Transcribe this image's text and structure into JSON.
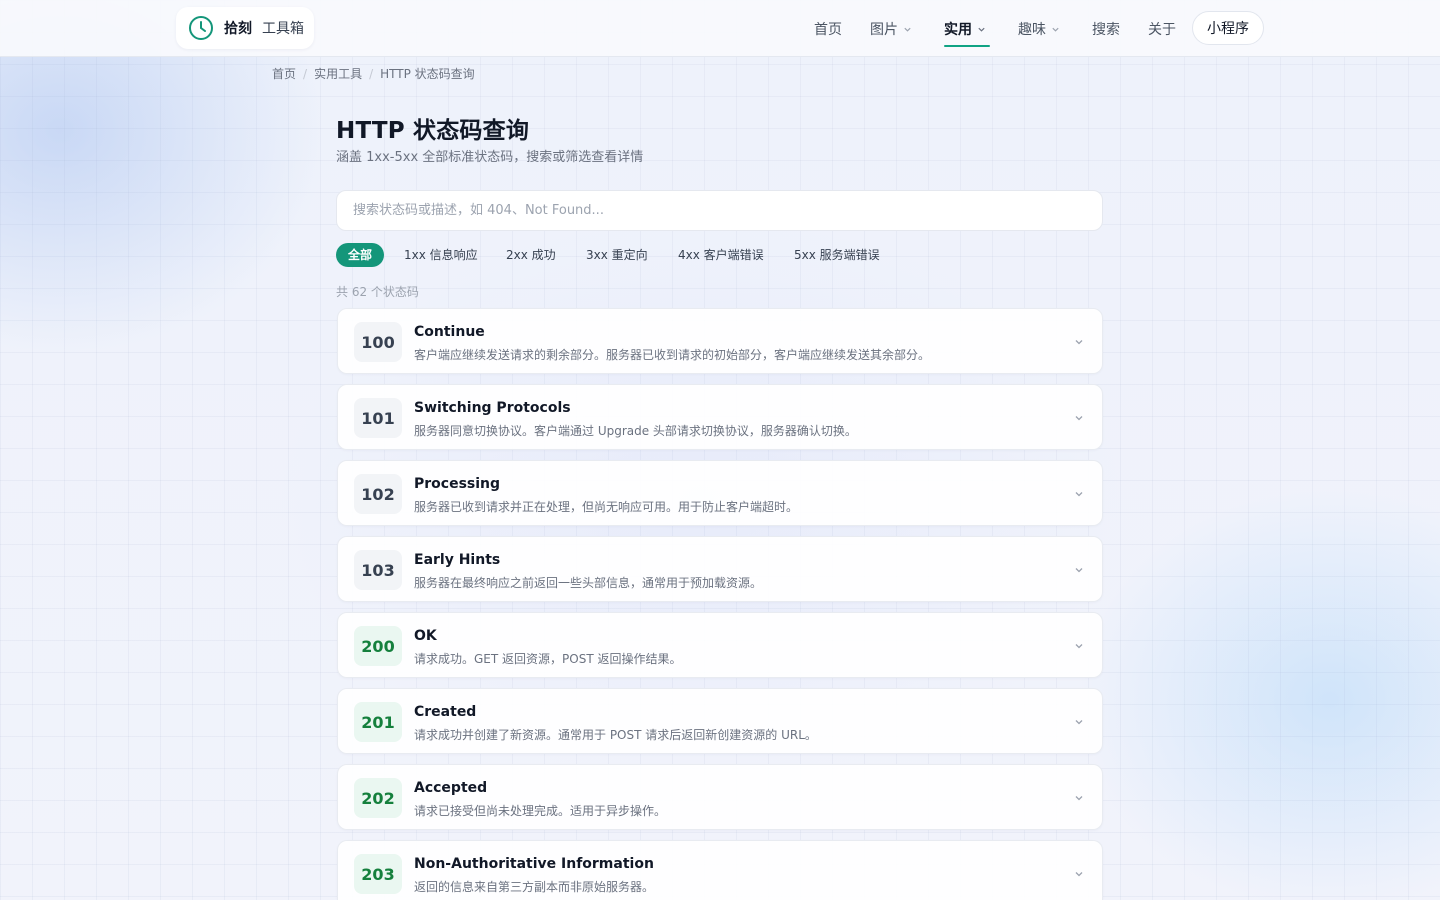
{
  "header": {
    "logo_main": "拾刻",
    "logo_sub": "工具箱",
    "nav": [
      "首页",
      "图片",
      "实用",
      "趣味",
      "搜索",
      "关于"
    ],
    "mini_program": "小程序"
  },
  "breadcrumb": [
    "首页",
    "实用工具",
    "HTTP 状态码查询"
  ],
  "page": {
    "title": "HTTP 状态码查询",
    "subtitle": "涵盖 1xx-5xx 全部标准状态码，搜索或筛选查看详情"
  },
  "search": {
    "placeholder": "搜索状态码或描述，如 404、Not Found...",
    "value": ""
  },
  "filters": [
    "全部",
    "1xx 信息响应",
    "2xx 成功",
    "3xx 重定向",
    "4xx 客户端错误",
    "5xx 服务端错误"
  ],
  "count_text": "共 62 个状态码",
  "items": [
    {
      "code": "100",
      "title": "Continue",
      "desc": "客户端应继续发送请求的剩余部分。服务器已收到请求的初始部分，客户端应继续发送其余部分。"
    },
    {
      "code": "101",
      "title": "Switching Protocols",
      "desc": "服务器同意切换协议。客户端通过 Upgrade 头部请求切换协议，服务器确认切换。"
    },
    {
      "code": "102",
      "title": "Processing",
      "desc": "服务器已收到请求并正在处理，但尚无响应可用。用于防止客户端超时。"
    },
    {
      "code": "103",
      "title": "Early Hints",
      "desc": "服务器在最终响应之前返回一些头部信息，通常用于预加载资源。"
    },
    {
      "code": "200",
      "title": "OK",
      "desc": "请求成功。GET 返回资源，POST 返回操作结果。"
    },
    {
      "code": "201",
      "title": "Created",
      "desc": "请求成功并创建了新资源。通常用于 POST 请求后返回新创建资源的 URL。"
    },
    {
      "code": "202",
      "title": "Accepted",
      "desc": "请求已接受但尚未处理完成。适用于异步操作。"
    },
    {
      "code": "203",
      "title": "Non-Authoritative Information",
      "desc": "返回的信息来自第三方副本而非原始服务器。"
    }
  ],
  "colors": {
    "accent": "#14967a",
    "code_1xx": "#374151",
    "code_2xx": "#15803d"
  }
}
